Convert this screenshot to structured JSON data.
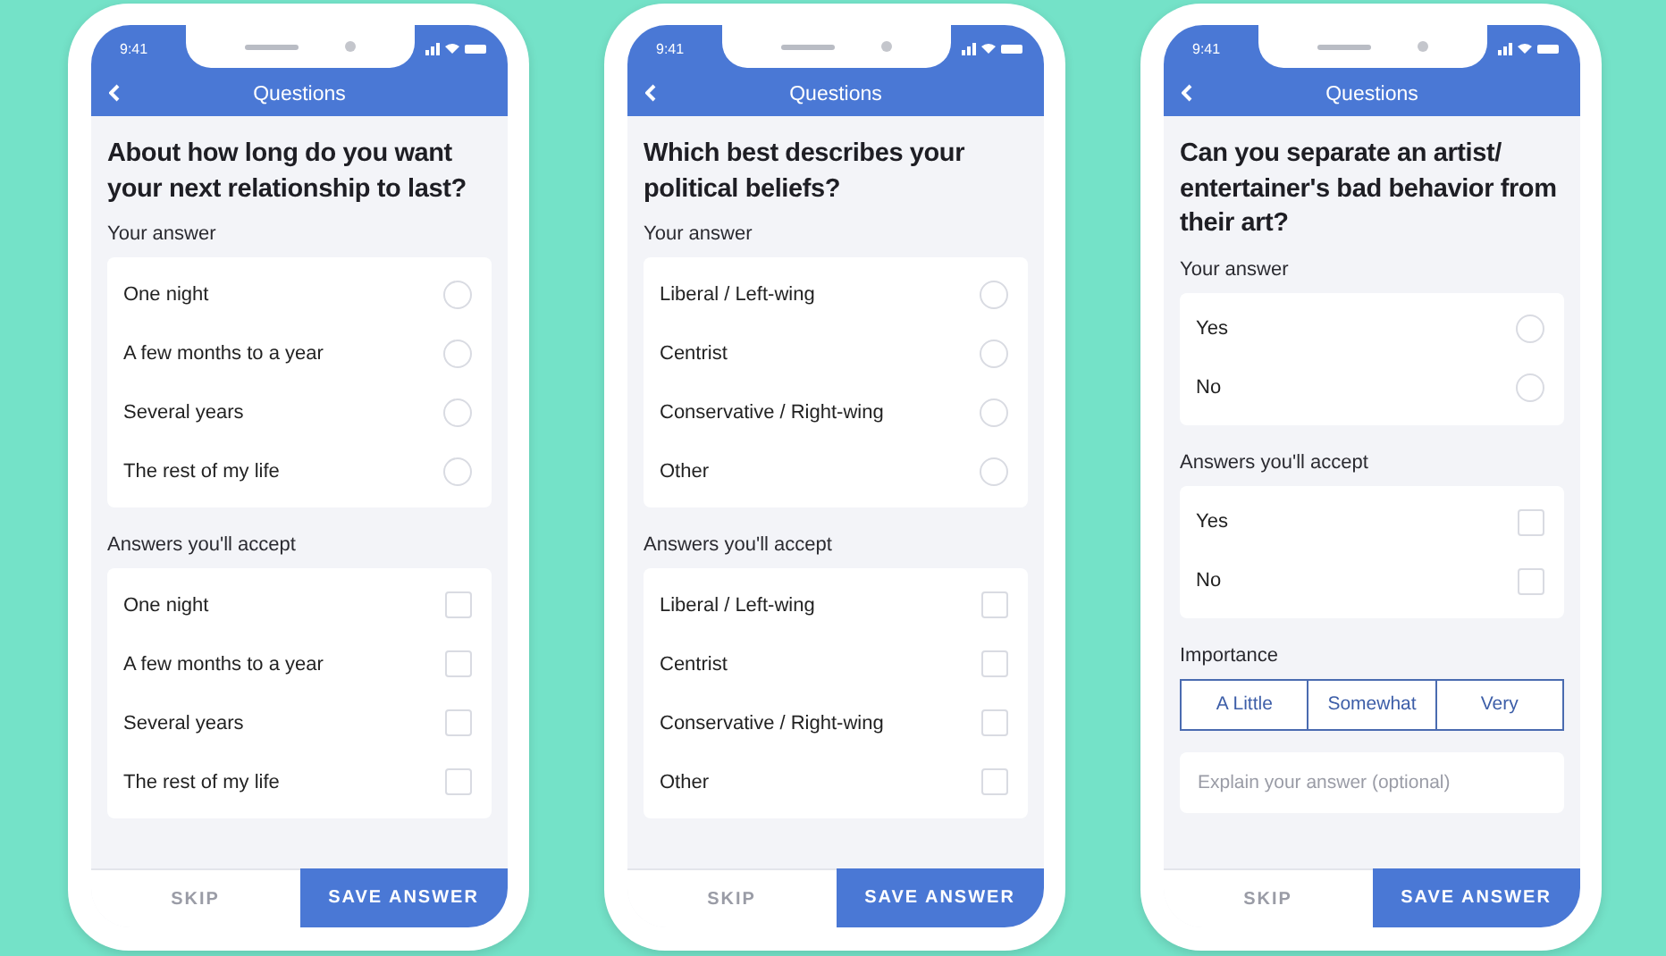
{
  "phones": [
    {
      "status_time": "9:41",
      "header_title": "Questions",
      "question": "About how long do you want your next relationship to last?",
      "answer_label": "Your answer",
      "answers": [
        {
          "label": "One night",
          "selected": false
        },
        {
          "label": "A few months to a year",
          "selected": false
        },
        {
          "label": "Several years",
          "selected": false
        },
        {
          "label": "The rest of my life",
          "selected": false
        }
      ],
      "accept_label": "Answers you'll accept",
      "accepts": [
        {
          "label": "One night",
          "checked": false
        },
        {
          "label": "A few months to a year",
          "checked": false
        },
        {
          "label": "Several years",
          "checked": false
        },
        {
          "label": "The rest of my life",
          "checked": false
        }
      ],
      "skip": "SKIP",
      "save": "SAVE ANSWER"
    },
    {
      "status_time": "9:41",
      "header_title": "Questions",
      "question": "Which best describes your political beliefs?",
      "answer_label": "Your answer",
      "answers": [
        {
          "label": "Liberal / Left-wing",
          "selected": false
        },
        {
          "label": "Centrist",
          "selected": false
        },
        {
          "label": "Conservative / Right-wing",
          "selected": false
        },
        {
          "label": "Other",
          "selected": false
        }
      ],
      "accept_label": "Answers you'll accept",
      "accepts": [
        {
          "label": "Liberal / Left-wing",
          "checked": false
        },
        {
          "label": "Centrist",
          "checked": false
        },
        {
          "label": "Conservative / Right-wing",
          "checked": false
        },
        {
          "label": "Other",
          "checked": false
        }
      ],
      "skip": "SKIP",
      "save": "SAVE ANSWER"
    },
    {
      "status_time": "9:41",
      "header_title": "Questions",
      "question": "Can you separate an artist/ entertainer's bad behavior from their art?",
      "answer_label": "Your answer",
      "answers": [
        {
          "label": "Yes",
          "selected": false
        },
        {
          "label": "No",
          "selected": false
        }
      ],
      "accept_label": "Answers you'll accept",
      "accepts": [
        {
          "label": "Yes",
          "checked": false
        },
        {
          "label": "No",
          "checked": false
        }
      ],
      "importance": {
        "label": "Importance",
        "options": [
          {
            "label": "A Little",
            "selected": false
          },
          {
            "label": "Somewhat",
            "selected": false
          },
          {
            "label": "Very",
            "selected": false
          }
        ]
      },
      "explain": {
        "placeholder": "Explain your answer (optional)"
      },
      "skip": "SKIP",
      "save": "SAVE ANSWER"
    }
  ]
}
